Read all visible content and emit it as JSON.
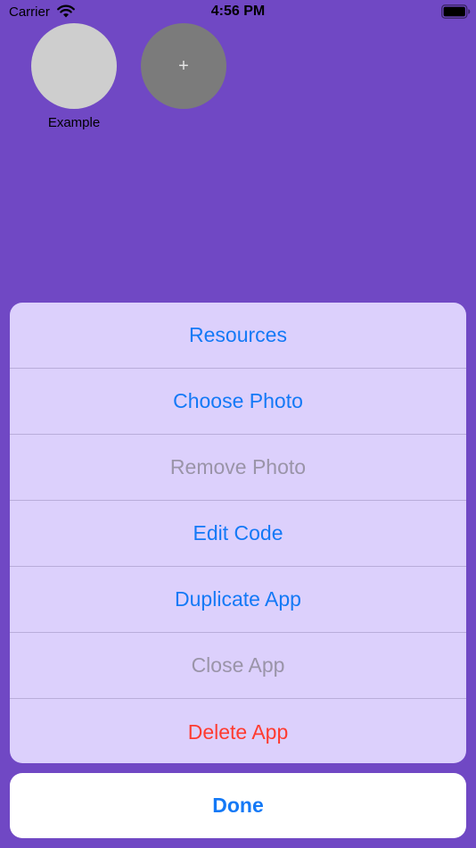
{
  "status_bar": {
    "carrier": "Carrier",
    "time": "4:56 PM",
    "wifi_icon": "wifi-icon",
    "battery_icon": "battery-icon"
  },
  "apps": [
    {
      "label": "Example"
    },
    {
      "symbol": "+"
    }
  ],
  "action_sheet": {
    "items": [
      {
        "label": "Resources",
        "state": "enabled"
      },
      {
        "label": "Choose Photo",
        "state": "enabled"
      },
      {
        "label": "Remove Photo",
        "state": "disabled"
      },
      {
        "label": "Edit Code",
        "state": "enabled"
      },
      {
        "label": "Duplicate App",
        "state": "enabled"
      },
      {
        "label": "Close App",
        "state": "disabled"
      },
      {
        "label": "Delete App",
        "state": "destructive"
      }
    ],
    "done_label": "Done"
  },
  "colors": {
    "background": "#7048c4",
    "tint": "#1479f6",
    "destructive": "#ff3b30",
    "disabled": "#9a94a8",
    "sheet": "#dcd0fc"
  }
}
